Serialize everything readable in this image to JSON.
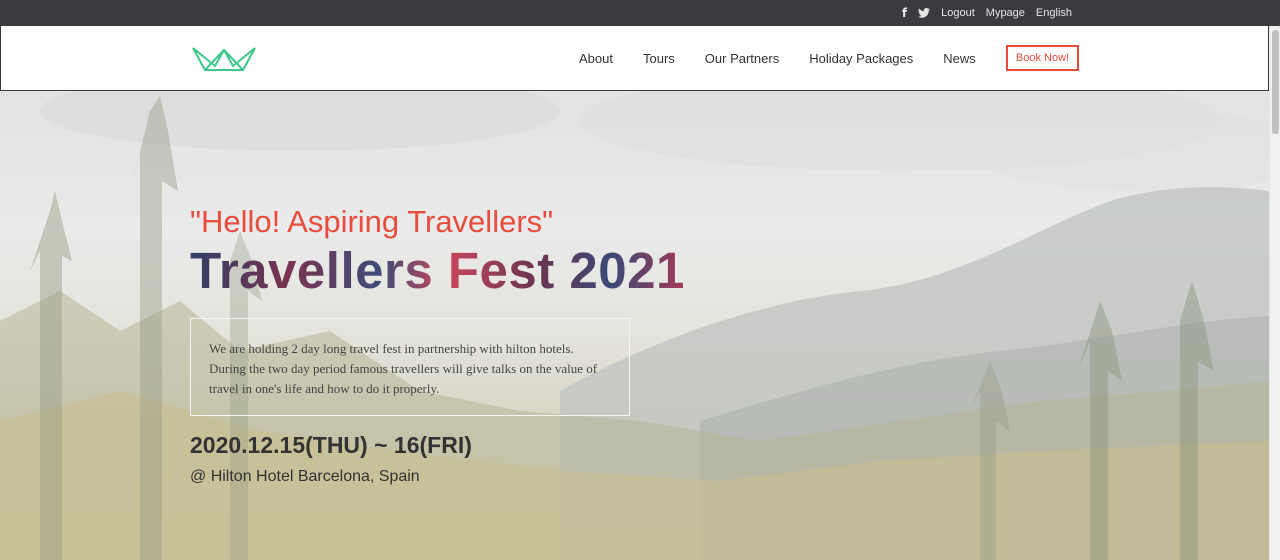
{
  "topbar": {
    "social": [
      {
        "icon": "facebook-icon",
        "glyph": "f"
      },
      {
        "icon": "twitter-icon"
      }
    ],
    "links": [
      "Logout",
      "Mypage",
      "English"
    ]
  },
  "header": {
    "logo_icon": "crown-outline-logo",
    "nav": [
      "About",
      "Tours",
      "Our Partners",
      "Holiday Packages",
      "News"
    ],
    "cta": "Book Now!"
  },
  "hero": {
    "tagline": "\"Hello! Aspiring Travellers\"",
    "headline": "Travellers Fest 2021",
    "description": "We are holding 2 day long travel fest in partnership with hilton hotels. During the two day period famous travellers will give talks on the value of travel in one's life and how to do it properly.",
    "dates": "2020.12.15(THU) ~ 16(FRI)",
    "venue": "@ Hilton Hotel Barcelona, Spain"
  },
  "colors": {
    "accent": "#e74c3c",
    "topbar": "#3a3a3f",
    "logo": "#3ec78a"
  }
}
